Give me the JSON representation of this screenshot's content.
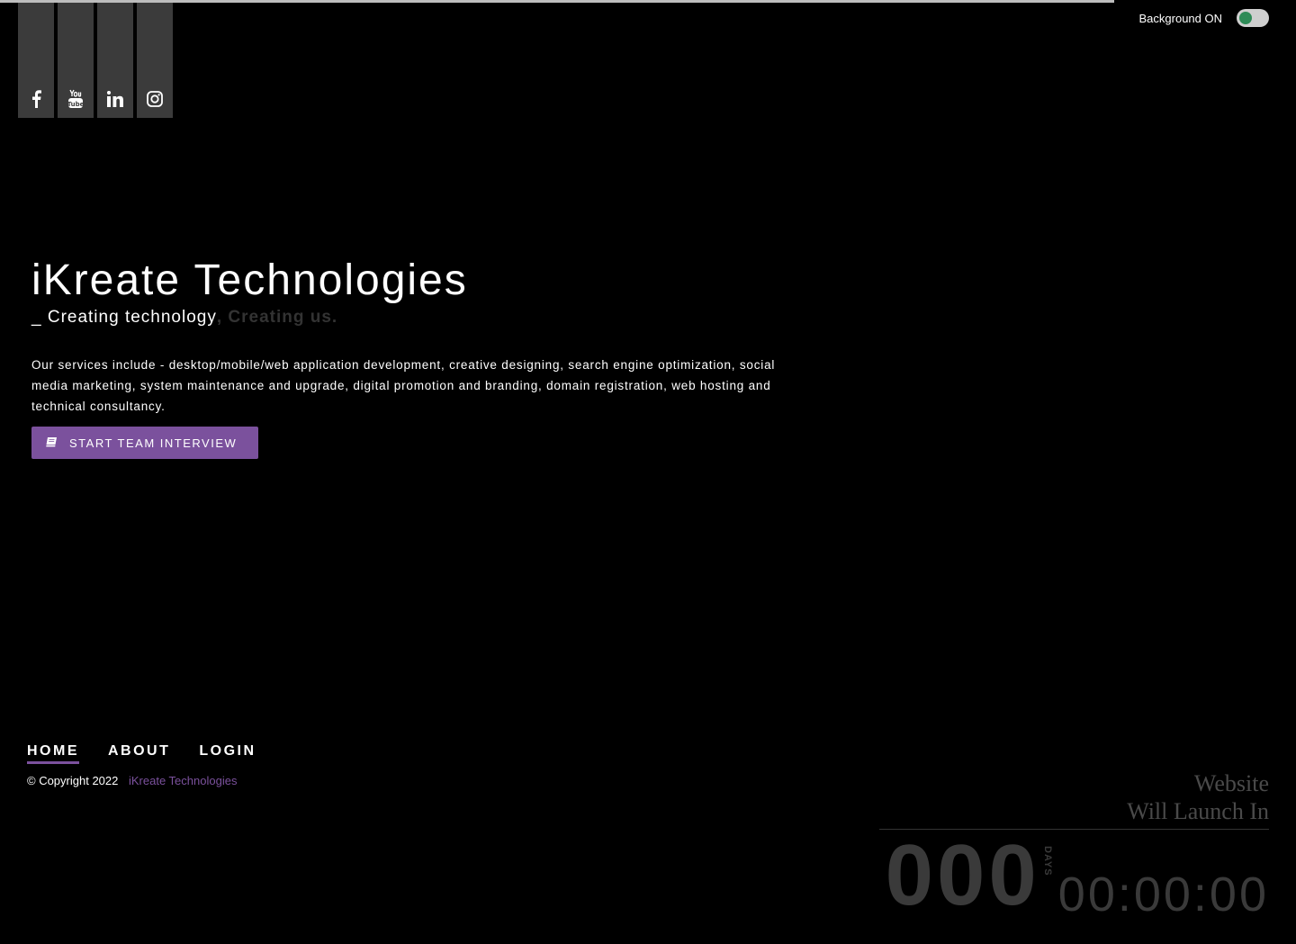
{
  "social": {
    "items": [
      {
        "name": "facebook",
        "icon": "facebook-icon"
      },
      {
        "name": "youtube",
        "icon": "youtube-icon"
      },
      {
        "name": "linkedin",
        "icon": "linkedin-icon"
      },
      {
        "name": "instagram",
        "icon": "instagram-icon"
      }
    ]
  },
  "background_toggle": {
    "label": "Background ON",
    "state": "on",
    "knob_color": "#2e8b57"
  },
  "hero": {
    "title": "iKreate Technologies",
    "tagline_lead": "_ Creating technology",
    "tagline_rest": ", Creating us.",
    "description": "Our services include - desktop/mobile/web application development, creative designing, search engine optimization, social media marketing, system maintenance and upgrade, digital promotion and branding, domain registration, web hosting and technical consultancy.",
    "cta_label": "START TEAM INTERVIEW",
    "cta_icon": "book-icon",
    "accent_color": "#7b519d"
  },
  "nav": {
    "items": [
      {
        "label": "HOME",
        "active": true
      },
      {
        "label": "ABOUT",
        "active": false
      },
      {
        "label": "LOGIN",
        "active": false
      }
    ]
  },
  "footer": {
    "copyright": "© Copyright 2022",
    "brand_link": "iKreate Technologies"
  },
  "launch": {
    "line1": "Website",
    "line2": "Will Launch In",
    "days": "000",
    "days_label": "DAYS",
    "clock": "00:00:00"
  }
}
